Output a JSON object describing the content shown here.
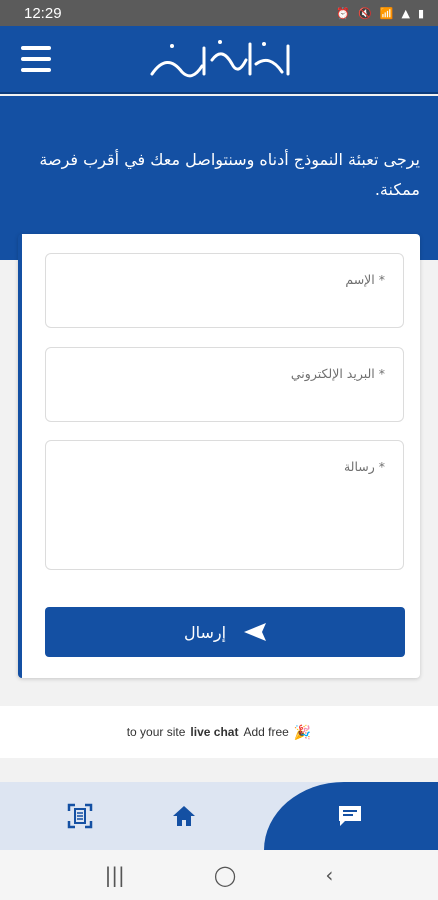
{
  "status_bar": {
    "time": "12:29"
  },
  "header": {
    "menu_icon": "hamburger-menu-icon",
    "logo_alt": "جامعة سيليون"
  },
  "hero": {
    "text": "يرجى تعبئة النموذج أدناه وسنتواصل معك في أقرب فرصة ممكنة."
  },
  "form": {
    "name_placeholder": "* الإسم",
    "email_placeholder": "* البريد الإلكتروني",
    "message_placeholder": "* رسالة",
    "send_label": "إرسال"
  },
  "promo": {
    "prefix": "to your site",
    "bold": "live chat",
    "suffix": "Add free",
    "icon": "🎉"
  },
  "bottom_nav": {
    "items": [
      "qr-scan-icon",
      "home-icon",
      "chat-icon"
    ]
  },
  "colors": {
    "primary": "#1450a3",
    "nav_bg": "#dde5f2"
  }
}
